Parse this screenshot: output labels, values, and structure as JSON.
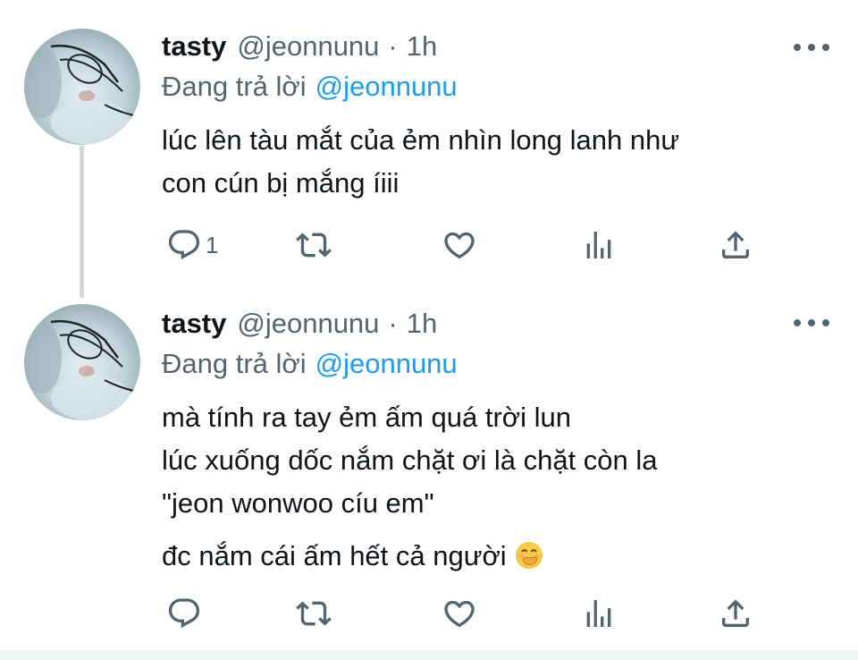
{
  "colors": {
    "accent": "#1d9bf0",
    "secondary_text": "#536471",
    "primary_text": "#0f1419",
    "thread_line": "#cfd9de"
  },
  "tweets": [
    {
      "display_name": "tasty",
      "handle": "@jeonnunu",
      "separator": "·",
      "time": "1h",
      "reply_prefix": "Đang trả lời",
      "reply_mention": "@jeonnunu",
      "body_lines": [
        "lúc lên tàu mắt của ẻm nhìn long lanh như",
        "con cún bị mắng íiii"
      ],
      "reply_count": "1",
      "icons": [
        "reply-icon",
        "retweet-icon",
        "like-icon",
        "views-icon",
        "share-icon",
        "more-icon"
      ]
    },
    {
      "display_name": "tasty",
      "handle": "@jeonnunu",
      "separator": "·",
      "time": "1h",
      "reply_prefix": "Đang trả lời",
      "reply_mention": "@jeonnunu",
      "body_lines": [
        "mà tính ra tay ẻm ấm quá trời lun",
        "lúc xuống dốc nắm chặt ơi là chặt còn la",
        "\"jeon wonwoo cíu em\""
      ],
      "body_last": "đc nắm cái ấm hết cả người",
      "emoji": "face-with-hand-over-mouth",
      "icons": [
        "reply-icon",
        "retweet-icon",
        "like-icon",
        "views-icon",
        "share-icon",
        "more-icon"
      ]
    }
  ]
}
